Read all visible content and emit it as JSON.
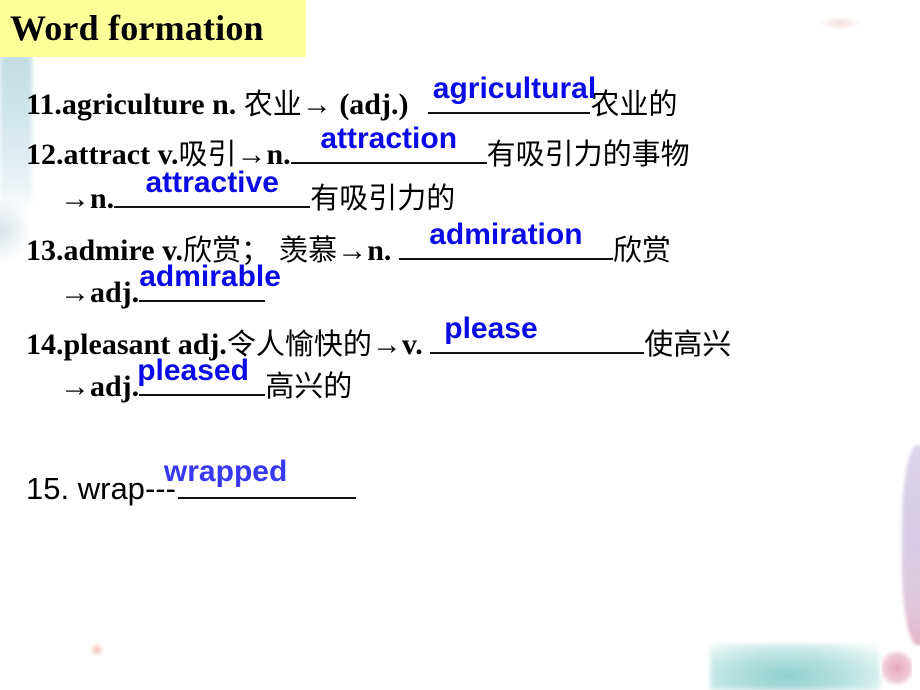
{
  "title": "Word formation",
  "colors": {
    "title_background": "#ffff99",
    "answer_text": "#0a0ae6",
    "answer_text_item15": "#3838f2"
  },
  "items": [
    {
      "number": "11.",
      "word": "agriculture",
      "pos": "n.",
      "meaning": "农业",
      "arrow": "→",
      "target_pos": "(adj.)",
      "answer": "agricultural",
      "target_meaning": "农业的"
    },
    {
      "number": "12.",
      "word": "attract",
      "pos": "v.",
      "meaning": "吸引",
      "arrow": "→",
      "target_pos": "n.",
      "answer": "attraction",
      "target_meaning": "有吸引力的事物",
      "sub": {
        "arrow": "→",
        "target_pos": "n.",
        "answer": "attractive",
        "target_meaning": "有吸引力的"
      }
    },
    {
      "number": "13.",
      "word": "admire",
      "pos": "v.",
      "meaning": "欣赏； 羡慕",
      "arrow": "→",
      "target_pos": "n.",
      "answer": "admiration",
      "target_meaning": "欣赏",
      "sub": {
        "arrow": "→",
        "target_pos": "adj.",
        "answer": "admirable",
        "target_meaning": ""
      }
    },
    {
      "number": "14.",
      "word": "pleasant",
      "pos": "adj.",
      "meaning": "令人愉快的",
      "arrow": "→",
      "target_pos": "v.",
      "answer": "please",
      "target_meaning": "使高兴",
      "sub": {
        "arrow": "→",
        "target_pos": "adj.",
        "answer": "pleased",
        "target_meaning": "高兴的"
      }
    },
    {
      "number": "15.",
      "word": "wrap",
      "separator": "---",
      "answer": "wrapped"
    }
  ]
}
